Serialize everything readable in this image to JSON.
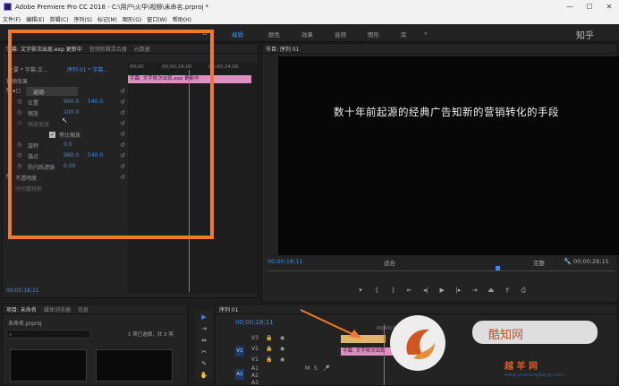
{
  "titlebar": {
    "title": "Adobe Premiere Pro CC 2018 - C:\\用户\\火华\\视频\\未命名.prproj *",
    "win_min": "—",
    "win_max": "☐",
    "win_close": "✕"
  },
  "menu": [
    "文件(F)",
    "编辑(E)",
    "剪辑(C)",
    "序列(S)",
    "标记(M)",
    "图形(G)",
    "窗口(W)",
    "帮助(H)"
  ],
  "workspace": {
    "tabs": [
      "编辑",
      "颜色",
      "效果",
      "音频",
      "图形",
      "库"
    ],
    "active": "编辑",
    "more": "»",
    "watermark_top": "知乎"
  },
  "effect_controls": {
    "tabs": [
      "字幕: 文字依次出现.exp 更新中",
      "音频剪辑混合器",
      "元数据"
    ],
    "master_label": "主要 * 字幕:文...",
    "sequence_label": "序列 01 * 字幕...",
    "section": "视频效果",
    "motion": "运动",
    "position_label": "位置",
    "position_x": "960.0",
    "position_y": "540.0",
    "scale_label": "缩放",
    "scale_value": "100.0",
    "scale_width_label": "缩放宽度",
    "uniform_label": "等比缩放",
    "rotation_label": "旋转",
    "rotation_value": "0.0",
    "anchor_label": "锚点",
    "anchor_x": "960.0",
    "anchor_y": "540.0",
    "antiflicker_label": "防闪烁滤镜",
    "antiflicker_value": "0.00",
    "opacity_label": "不透明度",
    "timeremap_label": "时间重映射",
    "timecode": "00;00;18;11"
  },
  "mini_timeline": {
    "ruler": [
      "00;00",
      "00;00;16;00",
      "00;00;24;00"
    ],
    "clip_label": "字幕: 文字依次出现.exp 更新中"
  },
  "program_monitor": {
    "title": "节目: 序列 01",
    "subtitle": "数十年前起源的经典广告知新的营销转化的手段",
    "timecode": "00;00;18;11",
    "fit": "适合",
    "quality": "完整",
    "duration": "00;00;28;15"
  },
  "project_panel": {
    "tabs": [
      "项目: 未命名",
      "媒体浏览器",
      "信息"
    ],
    "file": "未命名.prproj",
    "count": "1 项已选择，共 3 项",
    "search_placeholder": ""
  },
  "timeline": {
    "title": "序列 01",
    "timecode": "00;00;18;11",
    "ruler": [
      "00;00;16;00"
    ],
    "tracks": [
      "V3",
      "V2",
      "V1",
      "A1",
      "A2",
      "A3"
    ],
    "track_src_v": "V1",
    "track_src_a": "A1",
    "clip_label": "字幕: 文字依次出现"
  },
  "watermarks": {
    "kuzhi": "酷知网",
    "yueyang": "越 羊 网",
    "yueyang_url": "www.yueyangbang.com"
  },
  "colors": {
    "accent_blue": "#3f8ce8",
    "highlight_orange": "#f07a28",
    "clip_pink": "#e08fc1"
  }
}
